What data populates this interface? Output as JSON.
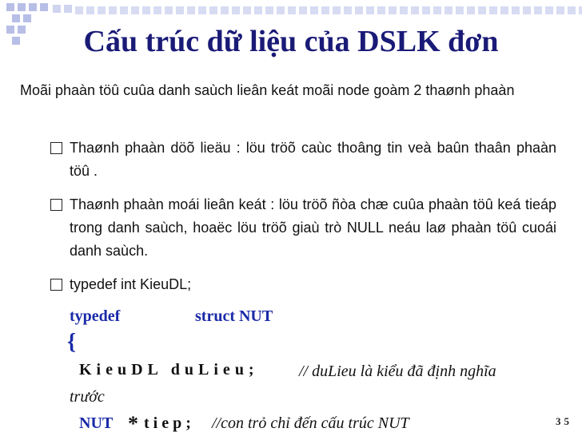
{
  "slide": {
    "title": "Cấu trúc dữ liệu của DSLK đơn",
    "intro": "Moãi phaàn töû cuûa danh saùch lieân keát moãi node goàm 2 thaønh phaàn",
    "bullets": [
      "Thaønh phaàn döõ lieäu : löu tröõ caùc thoâng tin veà baûn thaân phaàn töû .",
      "Thaønh phaàn moái lieân keát : löu tröõ  ñòa chæ cuûa phaàn töû keá tieáp trong danh saùch, hoaëc löu tröõ giaù trò NULL neáu laø phaàn töû cuoái danh saùch.",
      "typedef int KieuDL;"
    ],
    "code": {
      "typedef": "typedef",
      "struct": "struct  NUT",
      "brace": "{",
      "decl1": "KieuDL duLieu;",
      "comment1": "// duLieu là kiểu đã định nghĩa",
      "comment1_cont": "trước",
      "decl2_type": "NUT",
      "decl2_star": "*",
      "decl2_name": "tiep;",
      "comment2": "//con trỏ chỉ đến cấu trúc NUT"
    },
    "page_number": "35"
  }
}
